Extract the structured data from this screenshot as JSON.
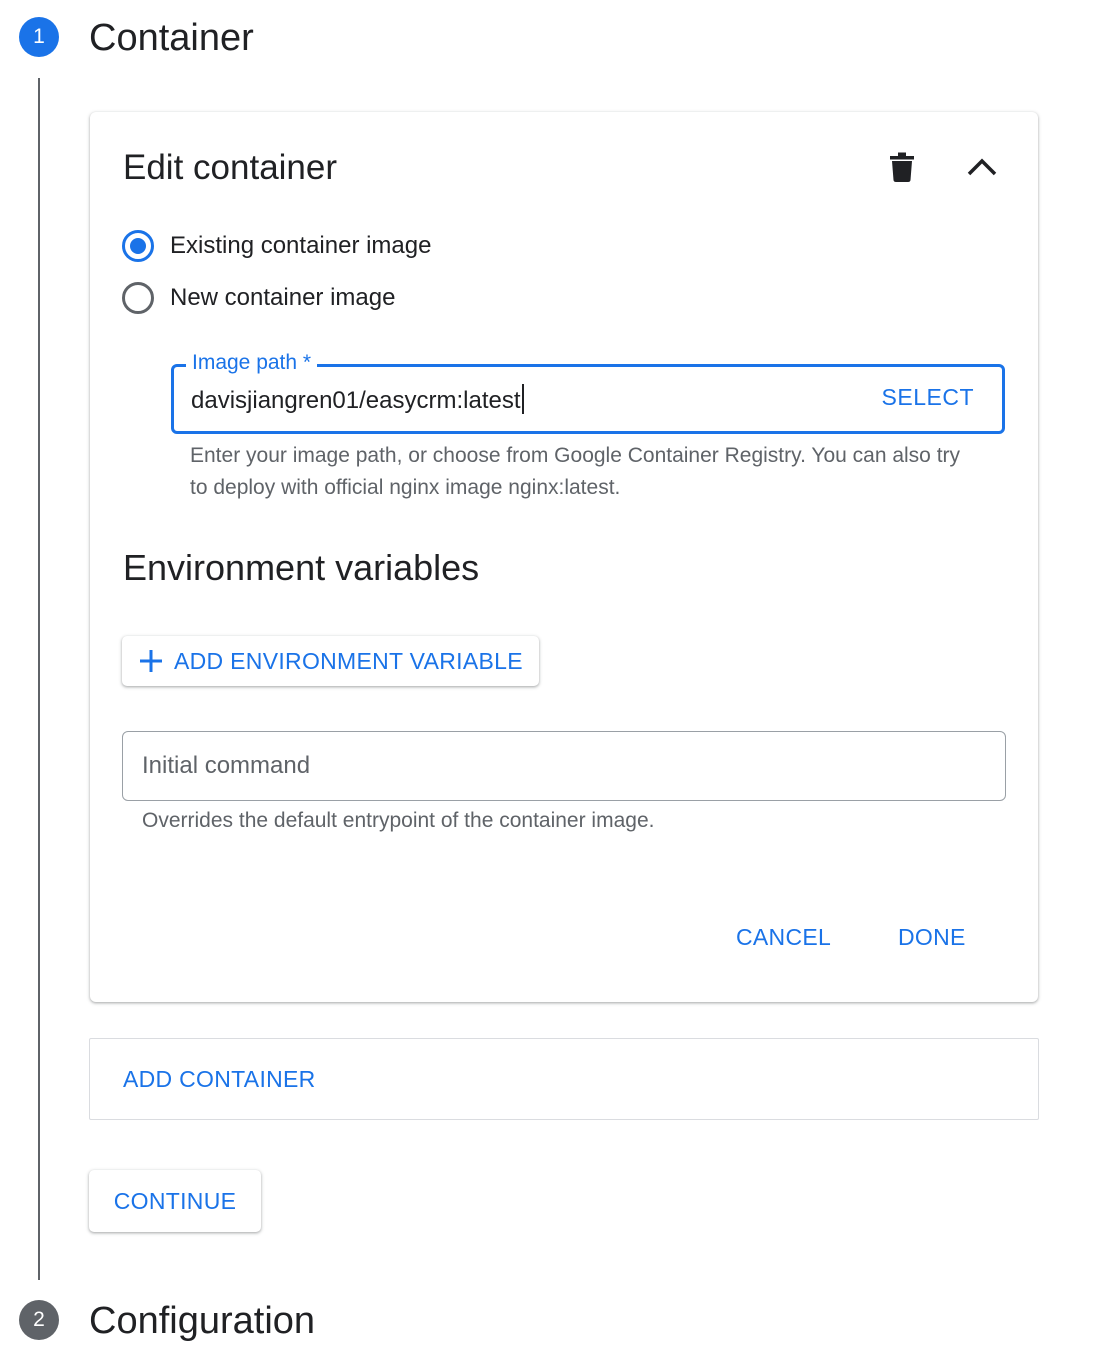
{
  "steps": [
    {
      "number": "1",
      "title": "Container",
      "state": "active"
    },
    {
      "number": "2",
      "title": "Configuration",
      "state": "inactive"
    }
  ],
  "card": {
    "title": "Edit container",
    "delete_icon": "trash-icon",
    "collapse_icon": "chevron-up-icon",
    "radio_options": [
      {
        "label": "Existing container image",
        "checked": true
      },
      {
        "label": "New container image",
        "checked": false
      }
    ],
    "image_path": {
      "label": "Image path *",
      "value": "davisjiangren01/easycrm:latest",
      "select_label": "SELECT",
      "hint": "Enter your image path, or choose from Google Container Registry. You can also try to deploy with official nginx image nginx:latest."
    },
    "env_section_title": "Environment variables",
    "add_env_label": "ADD ENVIRONMENT VARIABLE",
    "add_env_icon": "plus-icon",
    "initial_command": {
      "placeholder": "Initial command",
      "value": "",
      "hint": "Overrides the default entrypoint of the container image."
    },
    "cancel_label": "CANCEL",
    "done_label": "DONE"
  },
  "add_container_label": "ADD CONTAINER",
  "continue_label": "CONTINUE",
  "colors": {
    "accent": "#1a73e8",
    "text": "#202124",
    "secondary_text": "#5f6368"
  }
}
